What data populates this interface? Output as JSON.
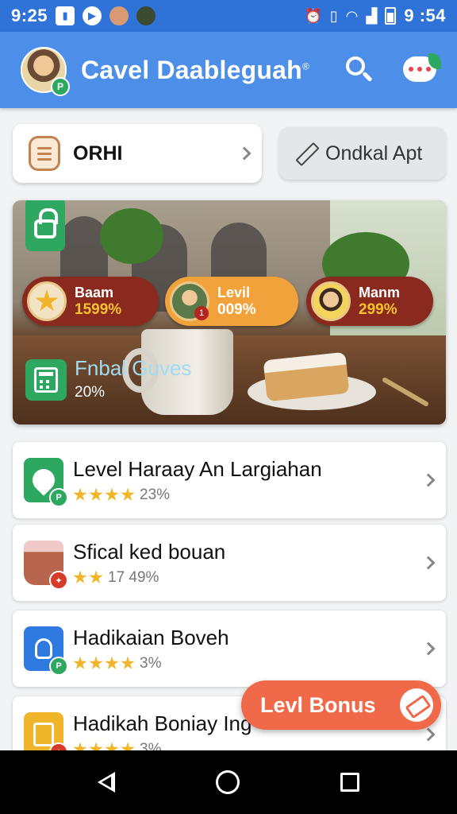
{
  "status_bar": {
    "time_left": "9:25",
    "time_right": "9 :54",
    "icons": [
      "sim-card-icon",
      "play-icon",
      "avatar-icon",
      "avatar-icon",
      "alarm-icon",
      "vibrate-icon",
      "wifi-icon",
      "signal-icon",
      "battery-icon"
    ]
  },
  "app_bar": {
    "title": "Cavel Daableguah",
    "title_mark": "®",
    "avatar_badge": "P",
    "search_icon": "search-icon",
    "chat_icon": "chat-icon"
  },
  "actions": {
    "primary_label": "ORHI",
    "secondary_label": "Ondkal Apt"
  },
  "hero": {
    "pills": [
      {
        "name": "Baam",
        "value": "1599%"
      },
      {
        "name": "Levil",
        "value": "009%",
        "badge": "1"
      },
      {
        "name": "Manm",
        "value": "299%"
      }
    ],
    "caption_title": "Fnbal Guves",
    "caption_pct": "20%"
  },
  "list": {
    "items": [
      {
        "title": "Level Haraay An Largiahan",
        "stars": 4,
        "pct": "23%",
        "badge": "P"
      },
      {
        "title": "Sfical ked bouan",
        "stars": 2,
        "pct": "17 49%",
        "badge": "✦"
      },
      {
        "title": "Hadikaian Boveh",
        "stars": 4,
        "pct": "3%",
        "badge": "P"
      },
      {
        "title": "Hadikah Boniay Ing",
        "stars": 4,
        "pct": "3%",
        "badge": "✦"
      }
    ]
  },
  "fab": {
    "label": "Levl Bonus"
  },
  "colors": {
    "status_bar": "#2f73d8",
    "app_bar": "#4c8ee8",
    "accent_green": "#2ea861",
    "fab": "#f06a4a",
    "star": "#f0b52a"
  }
}
